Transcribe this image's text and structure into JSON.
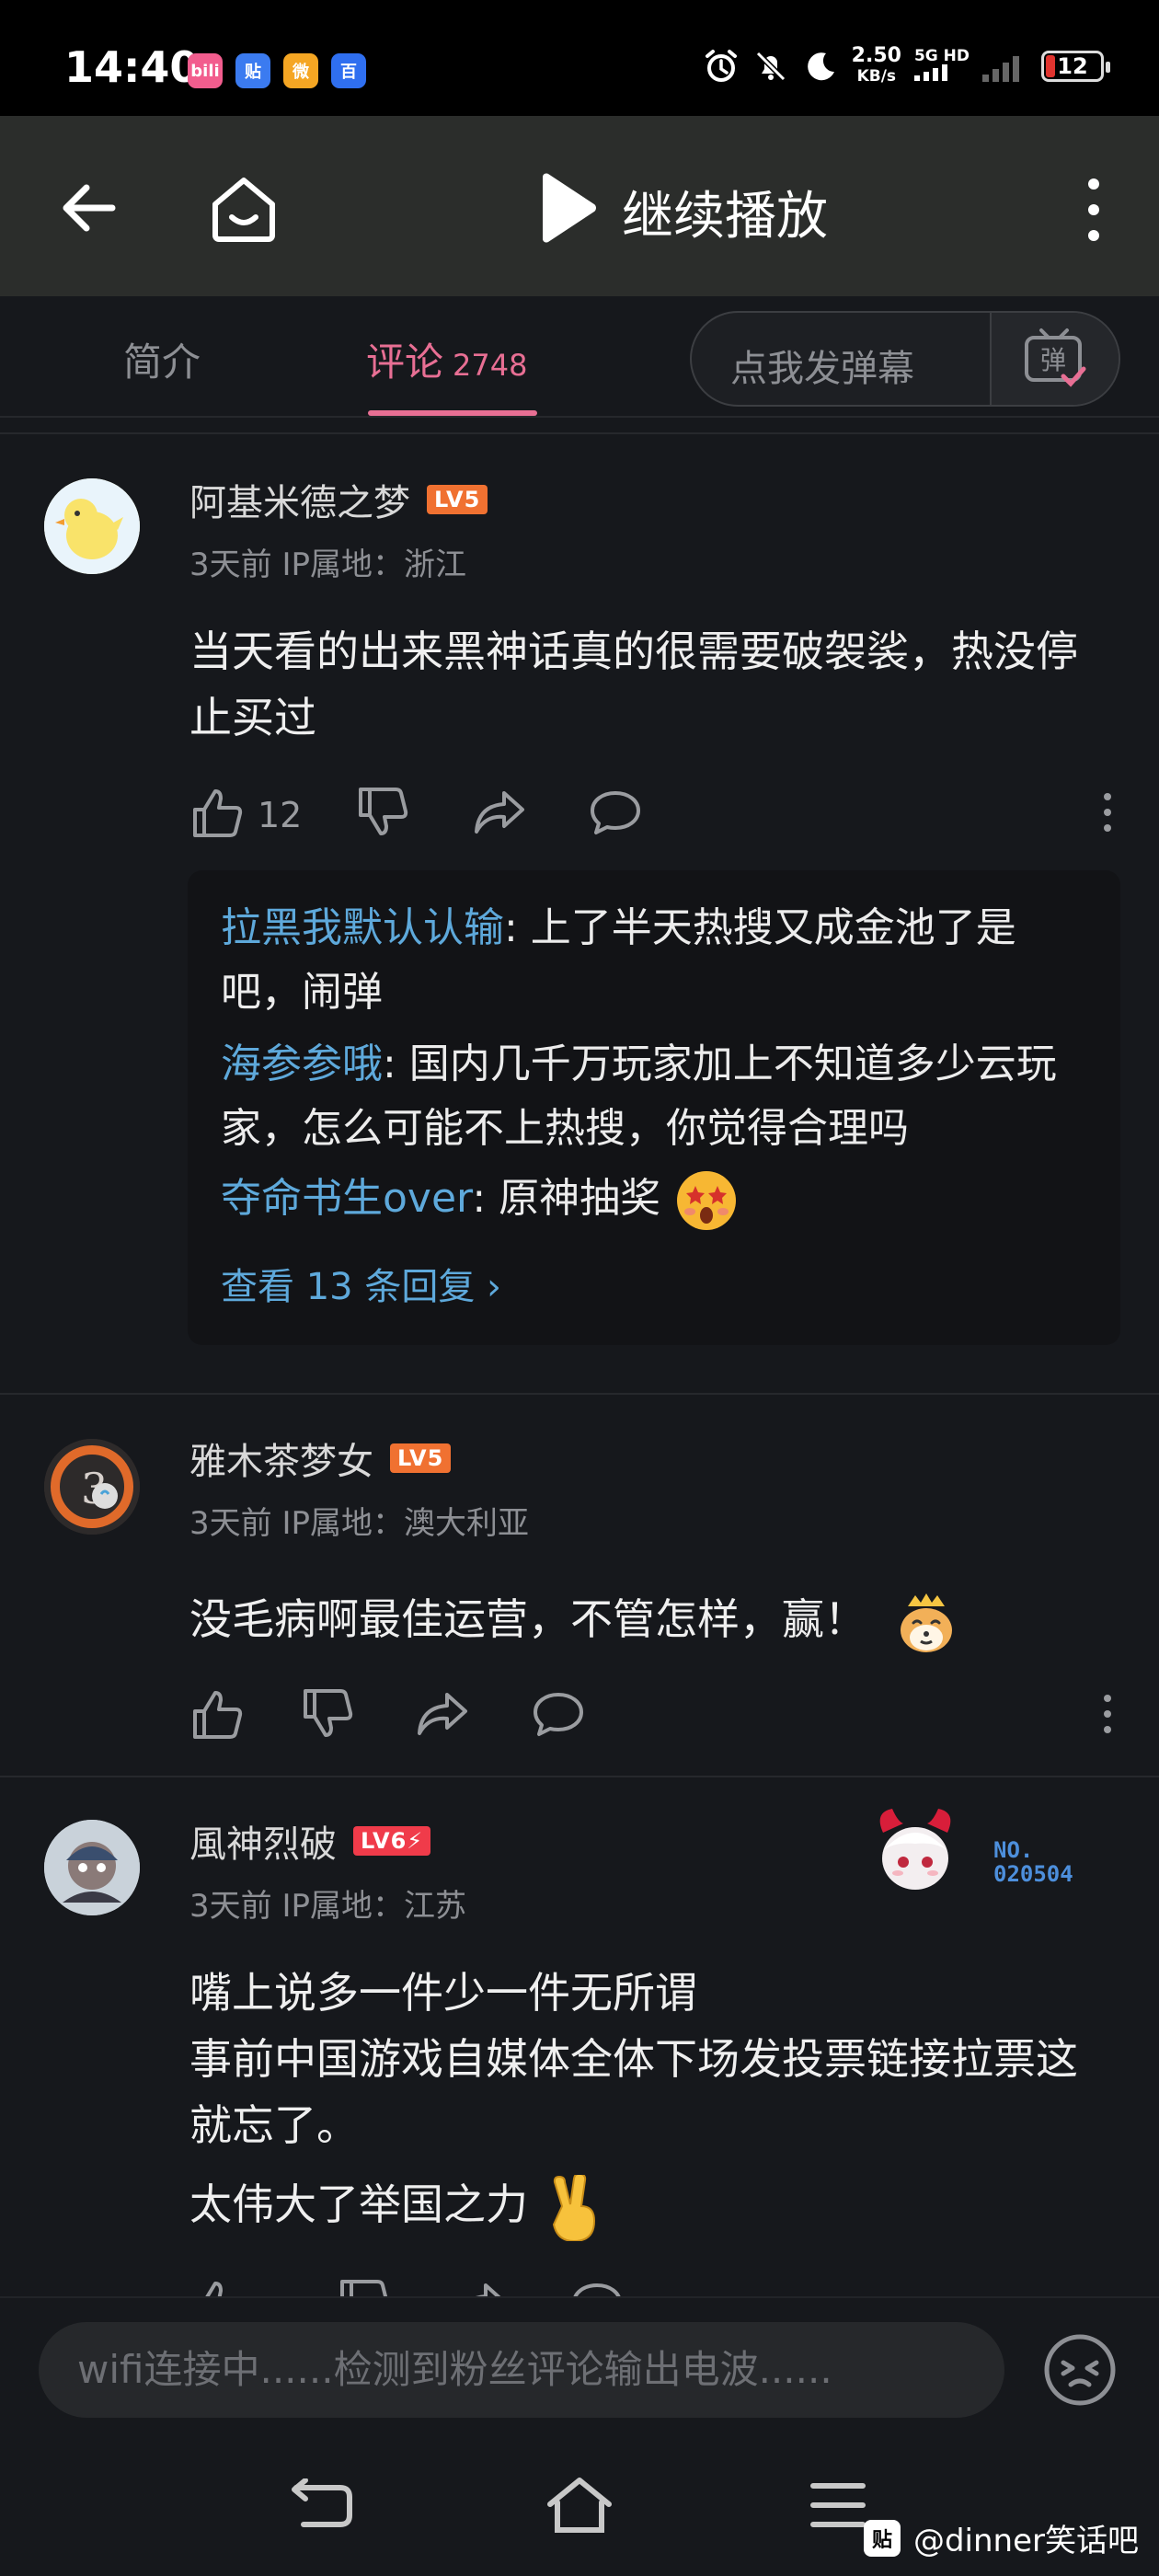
{
  "status_bar": {
    "time": "14:40",
    "speed_value": "2.50",
    "speed_unit": "KB/s",
    "network": "5G HD",
    "battery": "12",
    "app_icons": [
      {
        "name": "bilibili-icon",
        "color": "#f25d8e",
        "label": "bili"
      },
      {
        "name": "tieba-icon",
        "color": "#3b7bf0",
        "label": "贴"
      },
      {
        "name": "weibo-icon",
        "color": "#f5a623",
        "label": "微"
      },
      {
        "name": "baidu-icon",
        "color": "#2f6ff0",
        "label": "百"
      }
    ]
  },
  "header": {
    "title": "继续播放"
  },
  "tabs": {
    "intro": "简介",
    "comments": "评论",
    "comments_count": "2748",
    "danmaku_placeholder": "点我发弹幕",
    "danmaku_icon_label": "弹"
  },
  "comments": [
    {
      "username": "阿基米德之梦",
      "level": "LV5",
      "meta": "3天前 IP属地：浙江",
      "content": "当天看的出来黑神话真的很需要破袈裟，热没停止买过",
      "like_count": "12",
      "replies": [
        {
          "name": "拉黑我默认认输",
          "text": ": 上了半天热搜又成金池了是吧，闹弹"
        },
        {
          "name": "海参参哦",
          "text": ": 国内几千万玩家加上不知道多少云玩家，怎么可能不上热搜，你觉得合理吗"
        },
        {
          "name": "夺命书生over",
          "text": ": 原神抽奖"
        }
      ],
      "more_replies": "查看 13 条回复 ›"
    },
    {
      "username": "雅木茶梦女",
      "level": "LV5",
      "meta": "3天前 IP属地：澳大利亚",
      "content": "没毛病啊最佳运营，不管怎样，赢！",
      "like_count": ""
    },
    {
      "username": "風神烈破",
      "level": "LV6⚡",
      "meta": "3天前 IP属地：江苏",
      "content_lines": [
        "嘴上说多一件少一件无所谓",
        "事前中国游戏自媒体全体下场发投票链接拉票这就忘了。",
        "太伟大了举国之力"
      ],
      "fan_badge_no": "NO.",
      "fan_badge_num": "020504"
    }
  ],
  "input": {
    "placeholder": "wifi连接中......检测到粉丝评论输出电波......"
  },
  "watermark": {
    "icon": "贴",
    "text": "@dinner笑话吧"
  }
}
